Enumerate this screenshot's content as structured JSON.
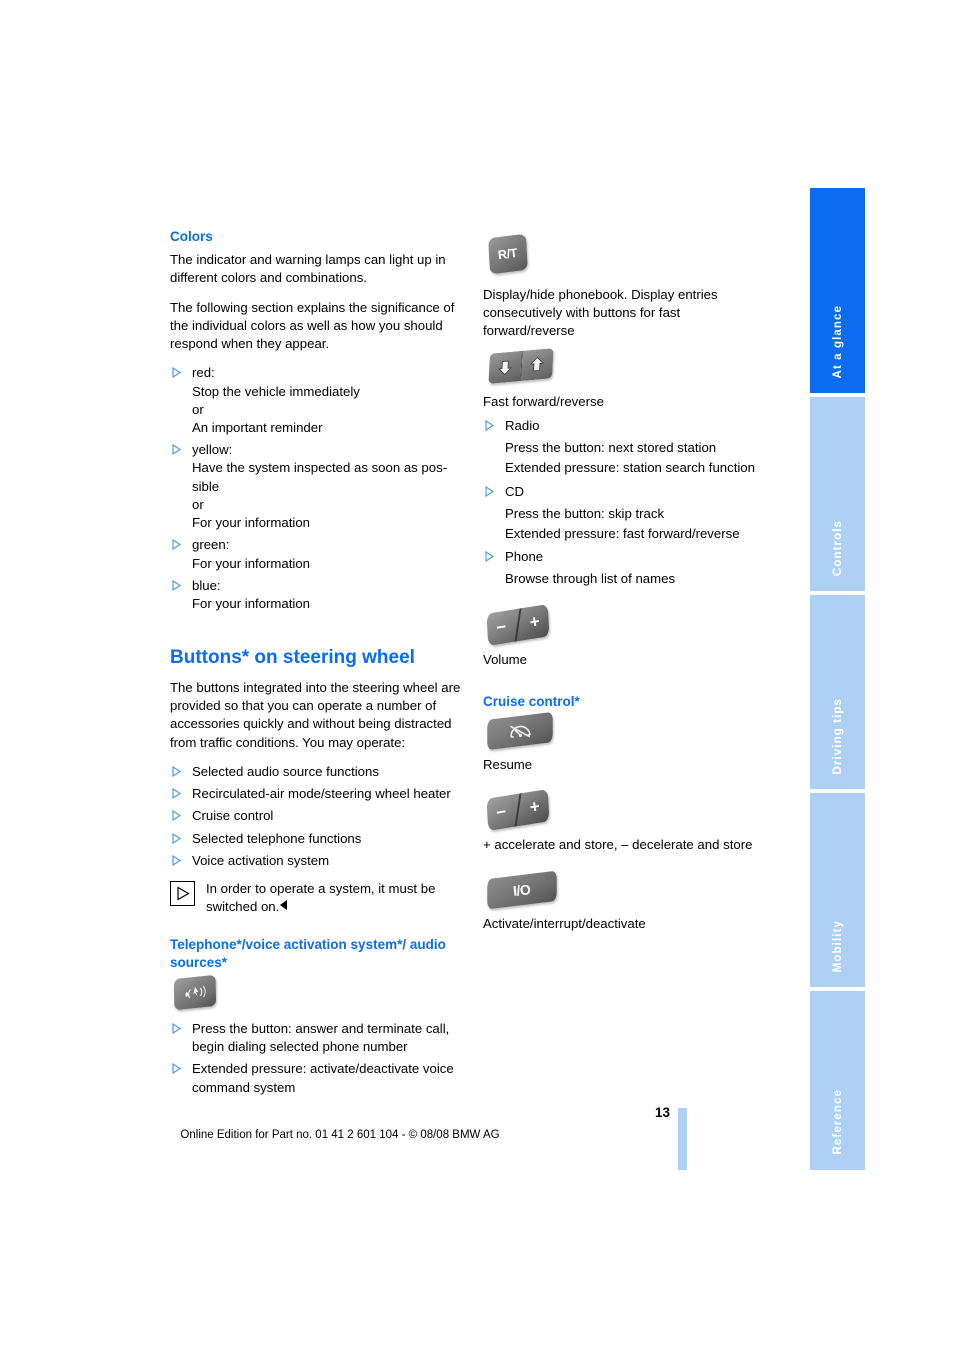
{
  "document": {
    "page_number": "13",
    "footer_note": "Online Edition for Part no. 01 41 2 601 104 - © 08/08 BMW AG"
  },
  "colors": {
    "accent_blue": "#0a6cf0",
    "tab_inactive": "#aed0f5",
    "tab_active": "#0a6cf0",
    "button_gray": "#7a7a7a"
  },
  "side_tabs": [
    {
      "label": "At a glance",
      "active": true
    },
    {
      "label": "Controls",
      "active": false
    },
    {
      "label": "Driving tips",
      "active": false
    },
    {
      "label": "Mobility",
      "active": false
    },
    {
      "label": "Reference",
      "active": false
    }
  ],
  "left_column": {
    "colors_section": {
      "heading": "Colors",
      "para1": "The indicator and warning lamps can light up in different colors and combinations.",
      "para2": "The following section explains the significance of the individual colors as well as how you should respond when they appear.",
      "items": [
        {
          "label": "red:",
          "lines": [
            "Stop the vehicle immediately",
            "or",
            "An important reminder"
          ]
        },
        {
          "label": "yellow:",
          "lines": [
            "Have the system inspected as soon as pos-sible",
            "or",
            "For your information"
          ]
        },
        {
          "label": "green:",
          "lines": [
            "For your information"
          ]
        },
        {
          "label": "blue:",
          "lines": [
            "For your information"
          ]
        }
      ]
    },
    "buttons_section": {
      "heading": "Buttons* on steering wheel",
      "intro": "The buttons integrated into the steering wheel are provided so that you can operate a number of accessories quickly and without being distracted from traffic conditions. You may operate:",
      "items": [
        "Selected audio source functions",
        "Recirculated-air mode/steering wheel heater",
        "Cruise control",
        "Selected telephone functions",
        "Voice activation system"
      ],
      "note": "In order to operate a system, it must be switched on.",
      "note_icon": "play-triangle-icon"
    },
    "telephone_section": {
      "heading": "Telephone*/voice activation system*/ audio sources*",
      "button_icon": "phone-voice-button-icon",
      "items": [
        "Press the button: answer and terminate call, begin dialing selected phone number",
        "Extended pressure: activate/deactivate voice command system"
      ]
    }
  },
  "right_column": {
    "rt_button": {
      "icon_label": "R/T",
      "icon_name": "rt-button-icon",
      "caption": "Display/hide phonebook. Display entries consecutively with buttons for fast forward/reverse"
    },
    "ff_rev_button": {
      "icon_name": "fast-forward-reverse-rocker-icon",
      "caption": "Fast forward/reverse",
      "items": [
        {
          "label": "Radio",
          "lines": [
            "Press the button: next stored station",
            "Extended pressure: station search function"
          ]
        },
        {
          "label": "CD",
          "lines": [
            "Press the button: skip track",
            "Extended pressure: fast forward/reverse"
          ]
        },
        {
          "label": "Phone",
          "lines": [
            "Browse through list of names"
          ]
        }
      ]
    },
    "volume_button": {
      "icon_name": "volume-rocker-icon",
      "minus": "−",
      "plus": "+",
      "caption": "Volume"
    },
    "cruise_control_section": {
      "heading": "Cruise control*",
      "resume": {
        "icon_name": "cruise-resume-button-icon",
        "caption": "Resume"
      },
      "accel": {
        "icon_name": "cruise-accelerate-decelerate-rocker-icon",
        "minus": "−",
        "plus": "+",
        "caption": "+ accelerate and store, – decelerate and store"
      },
      "onoff": {
        "icon_name": "cruise-io-button-icon",
        "icon_label": "I/O",
        "caption": "Activate/interrupt/deactivate"
      }
    }
  }
}
